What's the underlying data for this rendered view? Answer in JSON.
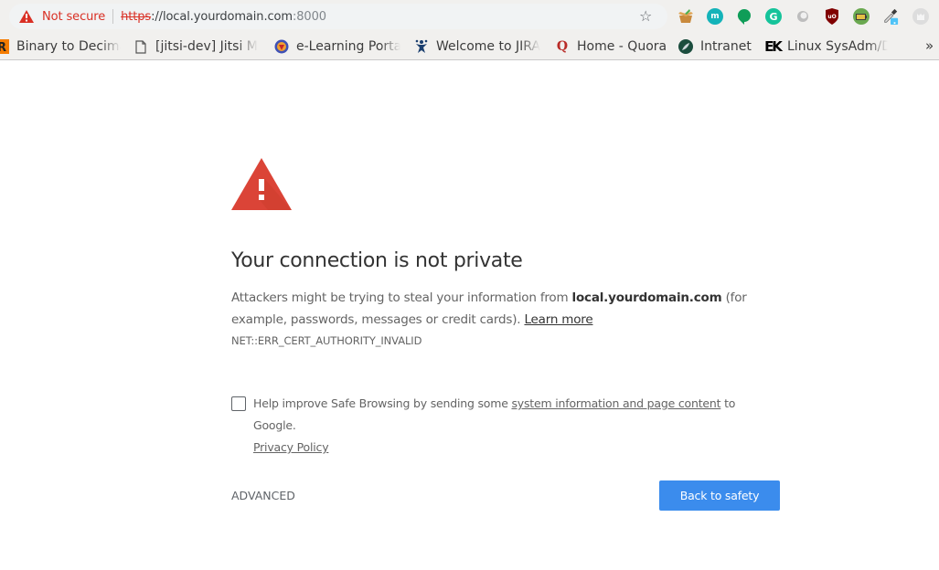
{
  "toolbar": {
    "security_label": "Not secure",
    "url_scheme": "https",
    "url_sep": "://",
    "url_host": "local.yourdomain.com",
    "url_port": ":8000",
    "bookmark_star_icon": "star-outline",
    "extensions": [
      {
        "name": "box-extension",
        "icon": "open-box"
      },
      {
        "name": "m-extension",
        "icon": "m",
        "color": "#14b3b9"
      },
      {
        "name": "hangouts-extension",
        "icon": "speech-bubble",
        "color": "#0f9d58"
      },
      {
        "name": "grammarly-extension",
        "icon": "G",
        "color": "#15c39a"
      },
      {
        "name": "gray-circle-extension",
        "icon": "circle",
        "color": "#bdbdbd"
      },
      {
        "name": "ublock-extension",
        "icon": "uO",
        "color": "#800000"
      },
      {
        "name": "battery-extension",
        "icon": "battery",
        "color": "#6aa84f"
      },
      {
        "name": "colorpicker-extension",
        "icon": "eyedropper",
        "color": "#4fc3f7"
      },
      {
        "name": "ghost-extension",
        "icon": "ghost",
        "color": "#dddddd"
      }
    ]
  },
  "bookmarks": {
    "items": [
      {
        "label": "Binary to Decima",
        "icon": "R"
      },
      {
        "label": "[jitsi-dev] Jitsi M",
        "icon": "page"
      },
      {
        "label": "e-Learning Porta",
        "icon": "emblem"
      },
      {
        "label": "Welcome to JIRA",
        "icon": "jira"
      },
      {
        "label": "Home - Quora",
        "icon": "Q"
      },
      {
        "label": "Intranet",
        "icon": "leaf"
      },
      {
        "label": "Linux SysAdm/D",
        "icon": "EK"
      }
    ],
    "overflow": "»"
  },
  "page": {
    "title": "Your connection is not private",
    "desc_pre": "Attackers might be trying to steal your information from ",
    "desc_host": "local.yourdomain.com",
    "desc_post": " (for example, passwords, messages or credit cards). ",
    "learn_more": "Learn more",
    "error_code": "NET::ERR_CERT_AUTHORITY_INVALID",
    "optin_pre": "Help improve Safe Browsing by sending some ",
    "optin_link": "system information and page content",
    "optin_post": " to Google.",
    "privacy_policy": "Privacy Policy",
    "optin_checked": false,
    "advanced": "ADVANCED",
    "back_to_safety": "Back to safety",
    "colors": {
      "warning": "#db4437",
      "primary_button": "#3b8ced",
      "not_secure": "#d93025"
    }
  }
}
